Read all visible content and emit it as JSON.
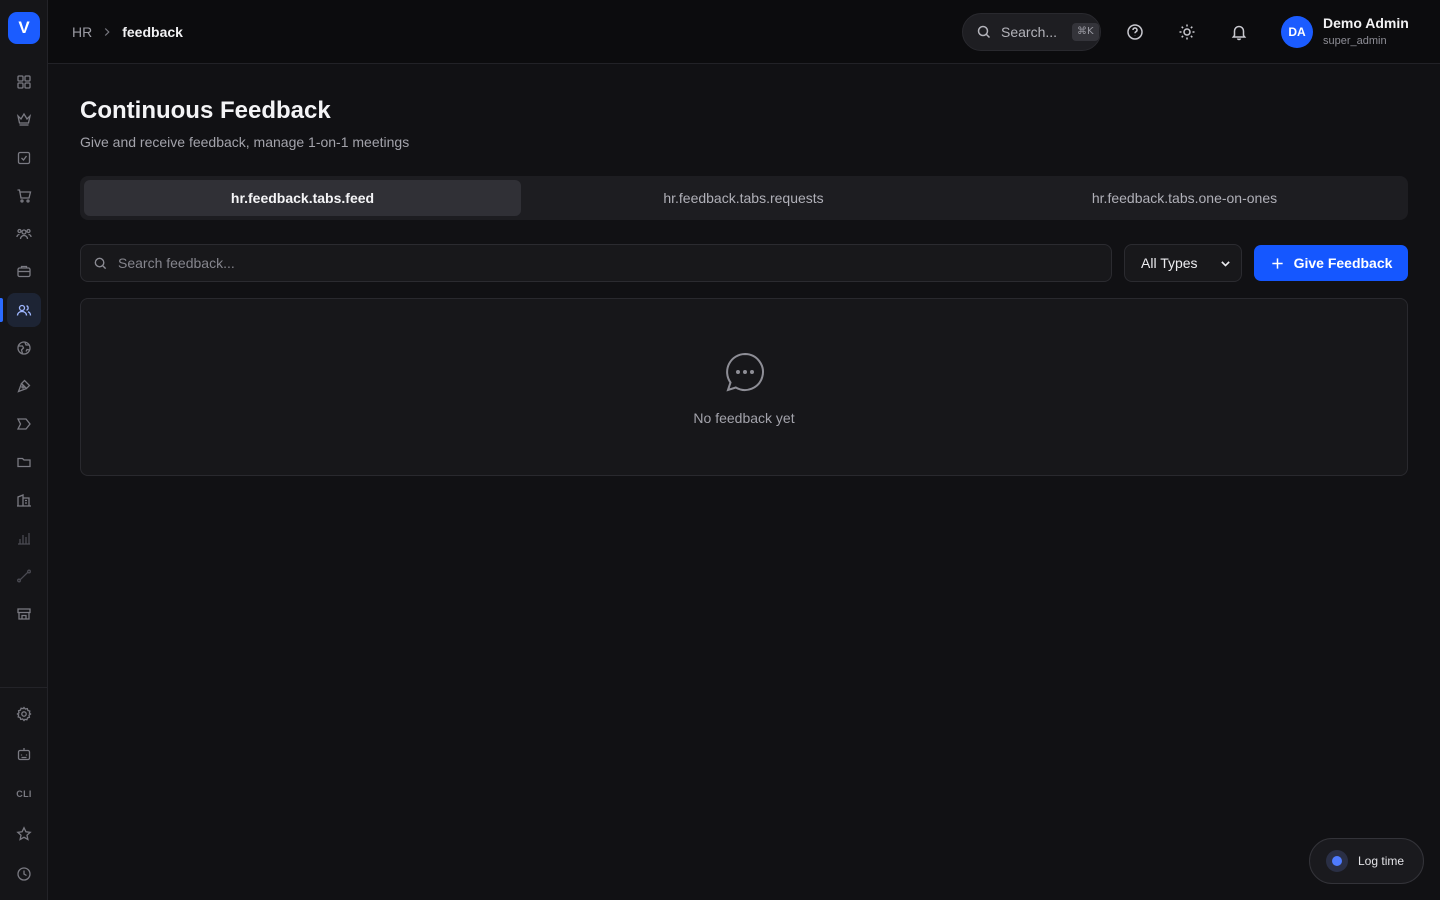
{
  "sidebar": {
    "logo": "V",
    "bottom_cli": "CLI"
  },
  "header": {
    "breadcrumb": {
      "root": "HR",
      "current": "feedback"
    },
    "search": {
      "label": "Search...",
      "shortcut": "⌘K"
    },
    "user": {
      "initials": "DA",
      "name": "Demo Admin",
      "role": "super_admin"
    }
  },
  "main": {
    "title": "Continuous Feedback",
    "subtitle": "Give and receive feedback, manage 1-on-1 meetings",
    "tabs": [
      {
        "label": "hr.feedback.tabs.feed",
        "active": true
      },
      {
        "label": "hr.feedback.tabs.requests",
        "active": false
      },
      {
        "label": "hr.feedback.tabs.one-on-ones",
        "active": false
      }
    ],
    "search_placeholder": "Search feedback...",
    "type_filter": {
      "selected": "All Types"
    },
    "give_button": "Give Feedback",
    "empty_message": "No feedback yet"
  },
  "floating": {
    "log_time": "Log time"
  },
  "colors": {
    "accent": "#1557ff",
    "background": "#111114",
    "header": "#0c0c0e"
  }
}
